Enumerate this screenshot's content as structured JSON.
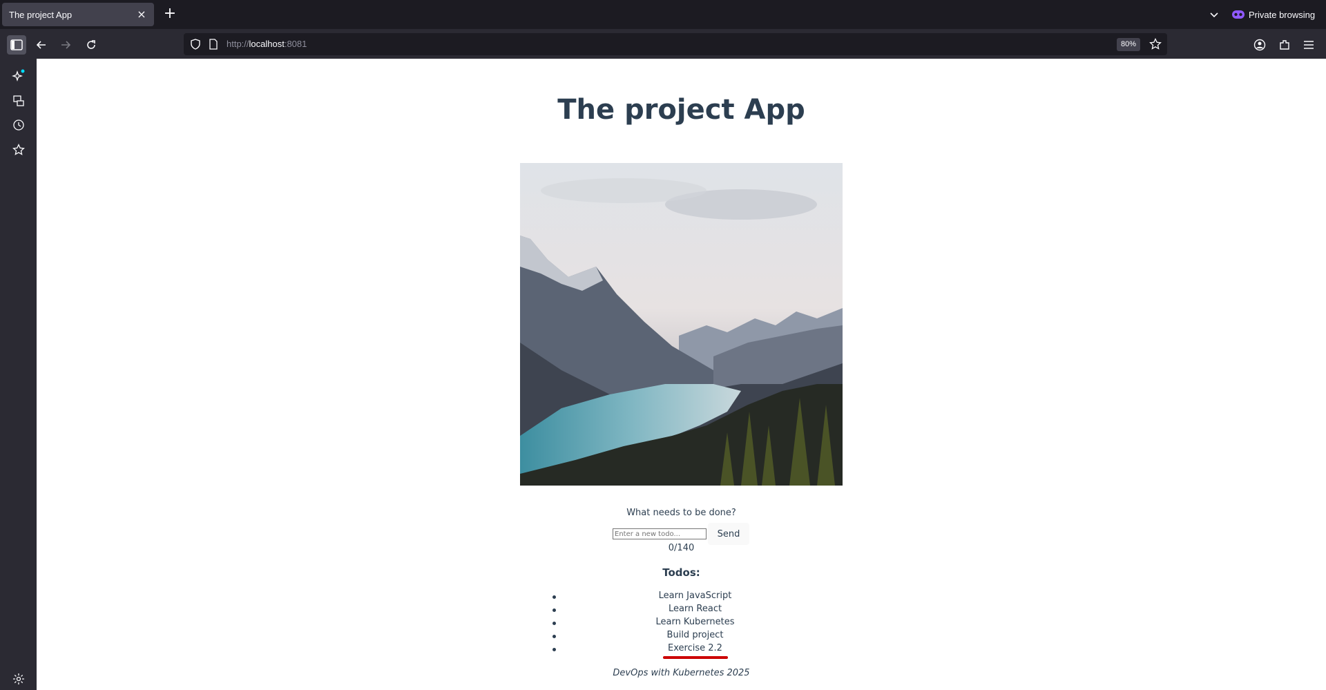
{
  "browser": {
    "tab_title": "The project App",
    "private_label": "Private browsing",
    "url_scheme": "http://",
    "url_host": "localhost",
    "url_port": ":8081",
    "zoom": "80%"
  },
  "page": {
    "title": "The project App",
    "prompt": "What needs to be done?",
    "input_placeholder": "Enter a new todo...",
    "send_label": "Send",
    "counter": "0/140",
    "todos_heading": "Todos:",
    "todos": [
      "Learn JavaScript",
      "Learn React",
      "Learn Kubernetes",
      "Build project",
      "Exercise 2.2"
    ],
    "footer": "DevOps with Kubernetes 2025"
  },
  "colors": {
    "text": "#2c3e50",
    "tabstrip_bg": "#1c1b22",
    "toolbar_bg": "#2b2a33",
    "annotation_underline": "#cc0000"
  }
}
